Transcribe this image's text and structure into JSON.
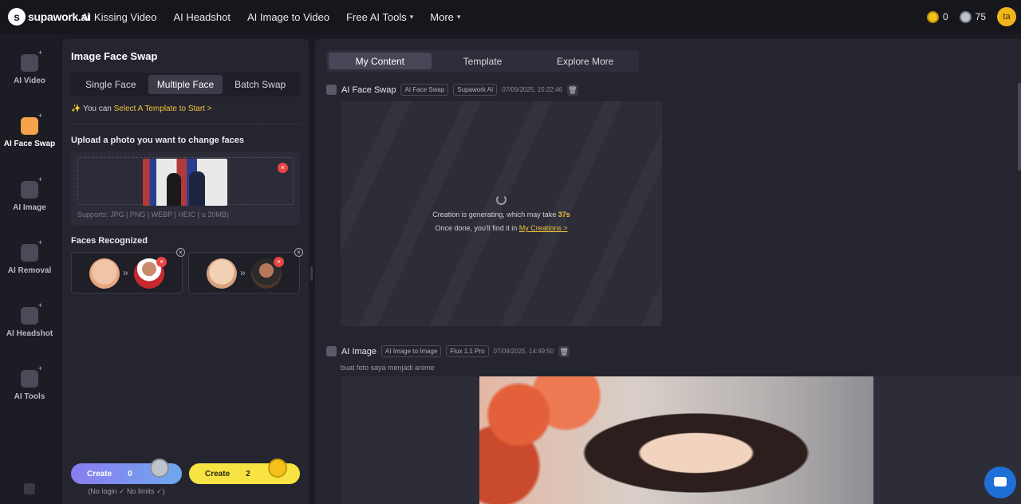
{
  "brand": {
    "logo_text": "supawork.ai"
  },
  "nav": {
    "links": [
      "AI Kissing Video",
      "AI Headshot",
      "AI Image to Video",
      "Free AI Tools",
      "More"
    ],
    "credits_gold": "0",
    "credits_silver": "75",
    "avatar_initials": "ta"
  },
  "rail": {
    "items": [
      "AI Video",
      "AI Face Swap",
      "AI Image",
      "AI Removal",
      "AI Headshot",
      "AI Tools"
    ]
  },
  "panel": {
    "title": "Image Face Swap",
    "modes": [
      "Single Face",
      "Multiple Face",
      "Batch Swap"
    ],
    "tip_prefix": "You can ",
    "tip_link": "Select A Template to Start >",
    "upload_label": "Upload a photo you want to change faces",
    "supports": "Supports: JPG | PNG | WEBP | HEIC ( ≤ 20MB)",
    "faces_label": "Faces Recognized",
    "arrow": "»",
    "create_free_label": "Create",
    "create_free_cost": "0",
    "create_paid_label": "Create",
    "create_paid_cost": "2",
    "nologin": "(No login ✓ No limits ✓)"
  },
  "content": {
    "tabs": [
      "My Content",
      "Template",
      "Explore More"
    ],
    "item1": {
      "title": "AI Face Swap",
      "chips": [
        "AI Face Swap",
        "Supawork AI"
      ],
      "timestamp": "07/09/2025, 15:22:46",
      "gen_line1_prefix": "Creation is generating, which may take ",
      "gen_line1_time": "37s",
      "gen_line2_prefix": "Once done, you'll find it in ",
      "gen_line2_link": "My Creations >"
    },
    "item2": {
      "title": "AI Image",
      "chips": [
        "AI Image to Image",
        "Flux 1.1 Pro"
      ],
      "timestamp": "07/09/2025, 14:49:50",
      "prompt": "buat foto saya menjadi anime"
    }
  },
  "icons": {
    "close": "×",
    "trash": "🗑",
    "chevron": "⌄",
    "spark": "✨"
  }
}
